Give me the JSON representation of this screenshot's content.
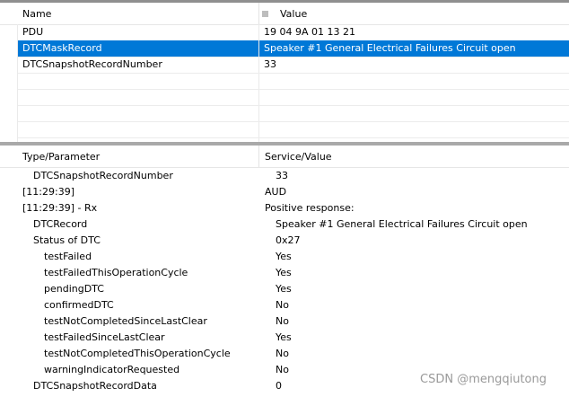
{
  "upper": {
    "columns": [
      "Name",
      "Value"
    ],
    "rows": [
      {
        "name": "PDU",
        "value": "19 04 9A 01 13 21"
      },
      {
        "name": "DTCMaskRecord",
        "value": "Speaker #1 General Electrical Failures Circuit open",
        "selected": true
      },
      {
        "name": "DTCSnapshotRecordNumber",
        "value": "33"
      }
    ]
  },
  "lower": {
    "columns": [
      "Type/Parameter",
      "Service/Value"
    ],
    "rows": [
      {
        "name": "DTCSnapshotRecordNumber",
        "value": "33",
        "indent": 1
      },
      {
        "name": "[11:29:39]",
        "value": "AUD",
        "indent": 0
      },
      {
        "name": "[11:29:39] - Rx",
        "value": "Positive response:",
        "indent": 0
      },
      {
        "name": "DTCRecord",
        "value": "Speaker #1 General Electrical Failures Circuit open",
        "indent": 1
      },
      {
        "name": "Status of DTC",
        "value": "0x27",
        "indent": 1
      },
      {
        "name": "testFailed",
        "value": "Yes",
        "indent": 2
      },
      {
        "name": "testFailedThisOperationCycle",
        "value": "Yes",
        "indent": 2
      },
      {
        "name": "pendingDTC",
        "value": "Yes",
        "indent": 2
      },
      {
        "name": "confirmedDTC",
        "value": "No",
        "indent": 2
      },
      {
        "name": "testNotCompletedSinceLastClear",
        "value": "No",
        "indent": 2
      },
      {
        "name": "testFailedSinceLastClear",
        "value": "Yes",
        "indent": 2
      },
      {
        "name": "testNotCompletedThisOperationCycle",
        "value": "No",
        "indent": 2
      },
      {
        "name": "warningIndicatorRequested",
        "value": "No",
        "indent": 2
      },
      {
        "name": "DTCSnapshotRecordData",
        "value": "0",
        "indent": 1
      }
    ]
  },
  "watermark": "CSDN @mengqiutong",
  "colors": {
    "selection": "#0078d7",
    "divider": "#a9a9a9"
  }
}
